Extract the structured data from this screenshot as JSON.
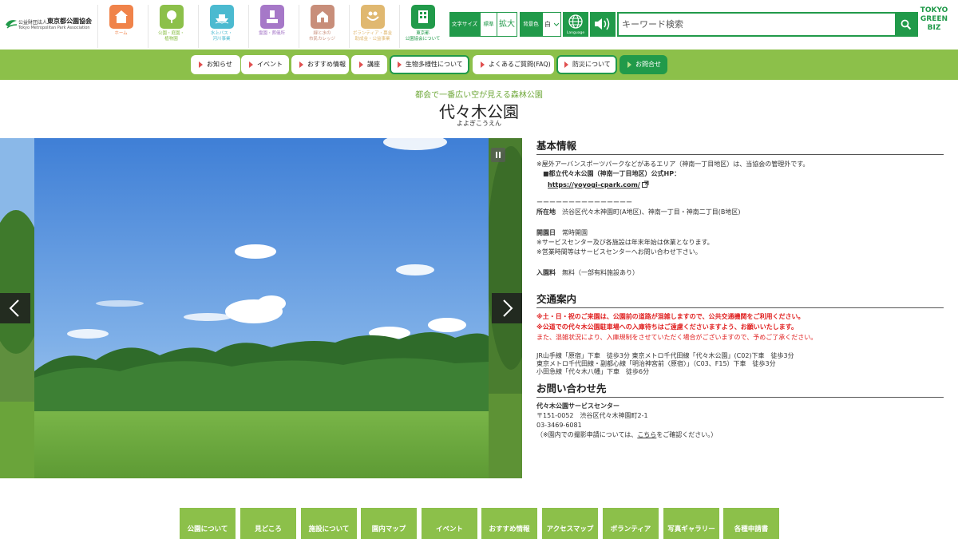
{
  "org": {
    "small": "公益財団法人",
    "main": "東京都公園協会",
    "en": "Tokyo Metropolitan Park Association"
  },
  "nav_icons": [
    {
      "label": "ホーム",
      "color": "#f0834a",
      "text": "#f0834a"
    },
    {
      "label": "公園・庭園・\n植物園",
      "color": "#8cc04a",
      "text": "#8cc04a"
    },
    {
      "label": "水上バス・\n河川事業",
      "color": "#4bbad0",
      "text": "#4bbad0"
    },
    {
      "label": "霊園・葬儀所",
      "color": "#a678c8",
      "text": "#a678c8"
    },
    {
      "label": "緑と水の\n市民カレッジ",
      "color": "#c88e7a",
      "text": "#c88e7a"
    },
    {
      "label": "ボランティア・募金\n助成金・公益事業",
      "color": "#e0b870",
      "text": "#e0b870"
    },
    {
      "label": "東京都\n公園協会について",
      "color": "#219a4a",
      "text": "#219a4a"
    }
  ],
  "font_size": {
    "label": "文字サイズ",
    "standard": "標準",
    "large": "拡大"
  },
  "bg_color": {
    "label": "背景色",
    "value": "白"
  },
  "language_label": "Language",
  "search": {
    "placeholder": "キーワード検索"
  },
  "green_biz": [
    "TOKYO",
    "GREEN",
    "BIZ"
  ],
  "menu": [
    {
      "label": "お知らせ",
      "style": "plain"
    },
    {
      "label": "イベント",
      "style": "plain"
    },
    {
      "label": "おすすめ情報",
      "style": "plain"
    },
    {
      "label": "講座",
      "style": "plain"
    },
    {
      "label": "生物多様性について",
      "style": "outlined"
    },
    {
      "label": "よくあるご質問(FAQ)",
      "style": "plain"
    },
    {
      "label": "防災について",
      "style": "outlined"
    },
    {
      "label": "お問合せ",
      "style": "filled"
    }
  ],
  "page": {
    "tagline": "都会で一番広い空が見える森林公園",
    "title": "代々木公園",
    "kana": "よよぎこうえん"
  },
  "basic_info": {
    "title": "基本情報",
    "note1": "※屋外アーバンスポーツパークなどがあるエリア（神南一丁目地区）は、当協会の管理外です。",
    "note2": "■都立代々木公園（神南一丁目地区）公式HP：",
    "url": "https://yoyogi-cpark.com/",
    "divider": "ーーーーーーーーーーーーーーー",
    "address_label": "所在地",
    "address": "渋谷区代々木神園町(A地区)、神南一丁目・神南二丁目(B地区)",
    "open_label": "開園日",
    "open": "常時開園",
    "open_note1": "※サービスセンター及び各施設は年末年始は休業となります。",
    "open_note2": "※営業時間等はサービスセンターへお問い合わせ下さい。",
    "fee_label": "入園料",
    "fee": "無料（一部有料施設あり）"
  },
  "access": {
    "title": "交通案内",
    "red1": "※土・日・祝のご来園は、公園前の道路が混雑しますので、公共交通機関をご利用ください。",
    "red2": "※公道での代々木公園駐車場への入庫待ちはご遠慮くださいますよう、お願いいたします。",
    "red3": "また、混雑状況により、入庫規制をさせていただく場合がございますので、予めご了承ください。",
    "line1": "JR山手線「原宿」下車　徒歩3分 東京メトロ千代田線「代々木公園」(C02)下車　徒歩3分",
    "line2": "東京メトロ千代田線・副都心線「明治神宮前〈原宿〉」（C03、F15）下車　徒歩3分",
    "line3": "小田急線「代々木八幡」下車　徒歩6分"
  },
  "contact": {
    "title": "お問い合わせ先",
    "name": "代々木公園サービスセンター",
    "address": "〒151-0052　渋谷区代々木神園町2-1",
    "tel": "03-3469-6081",
    "note_pre": "（※園内での撮影申請については、",
    "note_link": "こちら",
    "note_post": "をご確認ください。）"
  },
  "bottom_nav": [
    "公園について",
    "見どころ",
    "施設について",
    "園内マップ",
    "イベント",
    "おすすめ情報",
    "アクセスマップ",
    "ボランティア",
    "写真ギャラリー",
    "各種申請書"
  ]
}
